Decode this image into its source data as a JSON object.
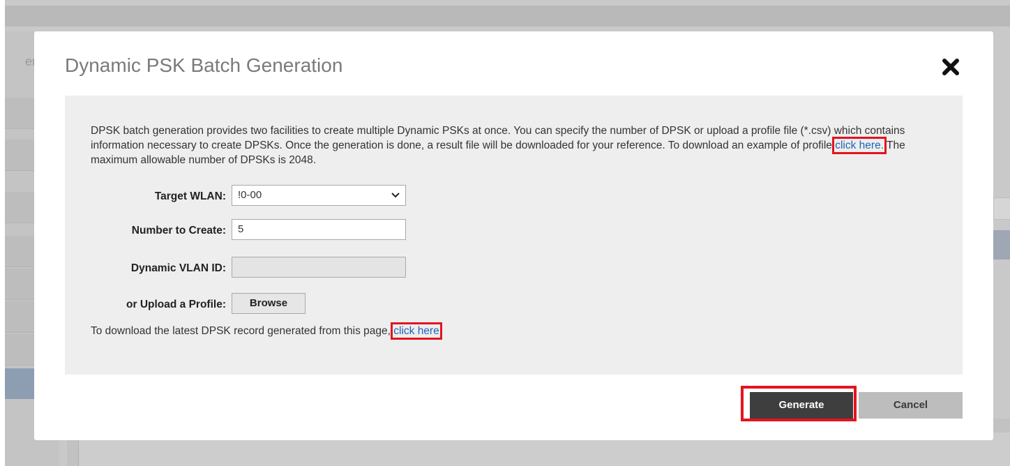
{
  "background": {
    "side_label": "ervic"
  },
  "dialog": {
    "title": "Dynamic PSK Batch Generation",
    "close_icon": "close-icon",
    "description": {
      "part1": "DPSK batch generation provides two facilities to create multiple Dynamic PSKs at once. You can specify the number of DPSK or upload a profile file (*.csv) which contains information necessary to create DPSKs. Once the generation is done, a result file will be downloaded for your reference. To download an example of profile ",
      "link": "click here.",
      "part2": " The maximum allowable number of DPSKs is 2048."
    },
    "form": {
      "target_wlan_label": "Target WLAN:",
      "target_wlan_value": "!0-00",
      "number_label": "Number to Create:",
      "number_value": "5",
      "vlan_label": "Dynamic VLAN ID:",
      "vlan_value": "",
      "upload_label": "or Upload a Profile:",
      "browse_label": "Browse"
    },
    "download": {
      "text": "To download the latest DPSK record generated from this page, ",
      "link": "click here"
    },
    "buttons": {
      "generate": "Generate",
      "cancel": "Cancel"
    },
    "colors": {
      "highlight": "#e3141f",
      "link": "#1f63b6",
      "generate_bg": "#3e3e3e",
      "cancel_bg": "#bdbdbd"
    }
  }
}
